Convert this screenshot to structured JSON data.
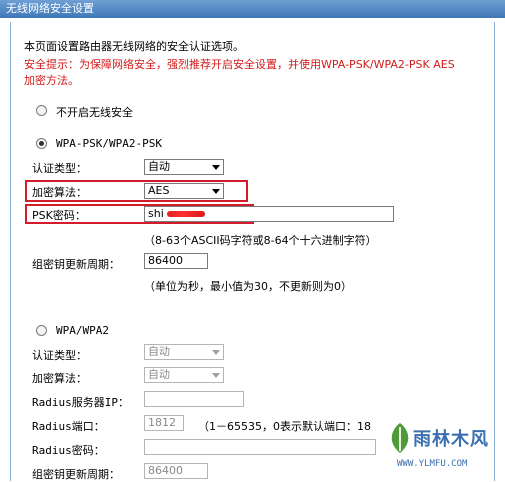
{
  "window": {
    "title": "无线网络安全设置"
  },
  "intro": {
    "text": "本页面设置路由器无线网络的安全认证选项。",
    "tip_line1": "安全提示：为保障网络安全，强烈推荐开启安全设置，并使用WPA-PSK/WPA2-PSK AES",
    "tip_line2": "加密方法。"
  },
  "options": {
    "none_label": "不开启无线安全",
    "wpa_psk_label": "WPA-PSK/WPA2-PSK",
    "wpa_label": "WPA/WPA2"
  },
  "psk": {
    "auth_label": "认证类型：",
    "auth_value": "自动",
    "enc_label": "加密算法：",
    "enc_value": "AES",
    "key_label": "PSK密码：",
    "key_value": "shi",
    "key_hint": "（8-63个ASCII码字符或8-64个十六进制字符）",
    "renew_label": "组密钥更新周期：",
    "renew_value": "86400",
    "renew_hint": "（单位为秒，最小值为30，不更新则为0）"
  },
  "wpa": {
    "auth_label": "认证类型：",
    "auth_value": "自动",
    "enc_label": "加密算法：",
    "enc_value": "自动",
    "radius_ip_label": "Radius服务器IP：",
    "radius_ip_value": "",
    "radius_port_label": "Radius端口：",
    "radius_port_value": "1812",
    "radius_port_hint": "（1－65535，0表示默认端口：18",
    "radius_pwd_label": "Radius密码：",
    "radius_pwd_value": "",
    "renew_label": "组密钥更新周期：",
    "renew_value": "86400"
  },
  "watermark": {
    "text": "雨林木风",
    "url": "WWW.YLMFU.COM"
  },
  "colors": {
    "warning": "#d21a1a",
    "highlight_box": "#d31b2b",
    "title_bar": "#3f78b8"
  }
}
